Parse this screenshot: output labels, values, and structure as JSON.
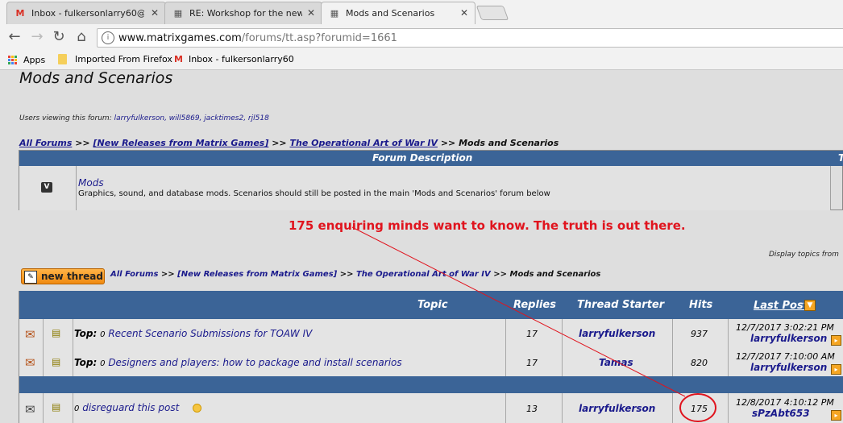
{
  "tabs": [
    {
      "label": "Inbox - fulkersonlarry60@g",
      "icon": "gmail-icon"
    },
    {
      "label": "RE: Workshop for the new",
      "icon": "forum-icon"
    },
    {
      "label": "Mods and Scenarios",
      "icon": "forum-icon"
    }
  ],
  "address": {
    "host": "www.matrixgames.com",
    "path": "/forums/tt.asp?forumid=1661"
  },
  "bookmarks": [
    {
      "label": "Apps",
      "icon": "apps-grid-icon"
    },
    {
      "label": "Imported From Firefox",
      "icon": "folder-icon"
    },
    {
      "label": "Inbox - fulkersonlarry60",
      "icon": "gmail-icon"
    }
  ],
  "page": {
    "title": "Mods and Scenarios",
    "viewers_label": "Users viewing this forum:",
    "viewers": "larryfulkerson, will5869, jacktimes2, rjl518",
    "breadcrumb": [
      "All Forums",
      "[New Releases from Matrix Games]",
      "The Operational Art of War IV",
      "Mods and Scenarios"
    ],
    "breadcrumb_sep": ">>",
    "forum_desc_header": "Forum Description",
    "forum_desc_header_right": "T",
    "subforum": {
      "name": "Mods",
      "desc": "Graphics, sound, and database mods. Scenarios should still be posted in the main 'Mods and Scenarios' forum below"
    },
    "annotation": "175 enquiring minds want to know.  The truth is out there.",
    "display_topics": "Display topics from",
    "new_thread_label": "new thread",
    "columns": {
      "topic": "Topic",
      "replies": "Replies",
      "starter": "Thread Starter",
      "hits": "Hits",
      "last_post": "Last Post"
    },
    "threads": [
      {
        "prefix": "Top:",
        "attach": "0",
        "title": "Recent Scenario Submissions for TOAW IV",
        "replies": "17",
        "starter": "larryfulkerson",
        "hits": "937",
        "last_date": "12/7/2017 3:02:21 PM",
        "last_user": "larryfulkerson"
      },
      {
        "prefix": "Top:",
        "attach": "0",
        "title": "Designers and players: how to package and install scenarios",
        "replies": "17",
        "starter": "Tamas",
        "hits": "820",
        "last_date": "12/7/2017 7:10:00 AM",
        "last_user": "larryfulkerson"
      },
      {
        "prefix": "",
        "attach": "0",
        "title": "disreguard this post",
        "replies": "13",
        "starter": "larryfulkerson",
        "hits": "175",
        "last_date": "12/8/2017 4:10:12 PM",
        "last_user": "sPzAbt653"
      }
    ]
  },
  "colors": {
    "header_blue": "#3b6497",
    "annotation_red": "#e0141e",
    "link_navy": "#1a1a8c"
  }
}
